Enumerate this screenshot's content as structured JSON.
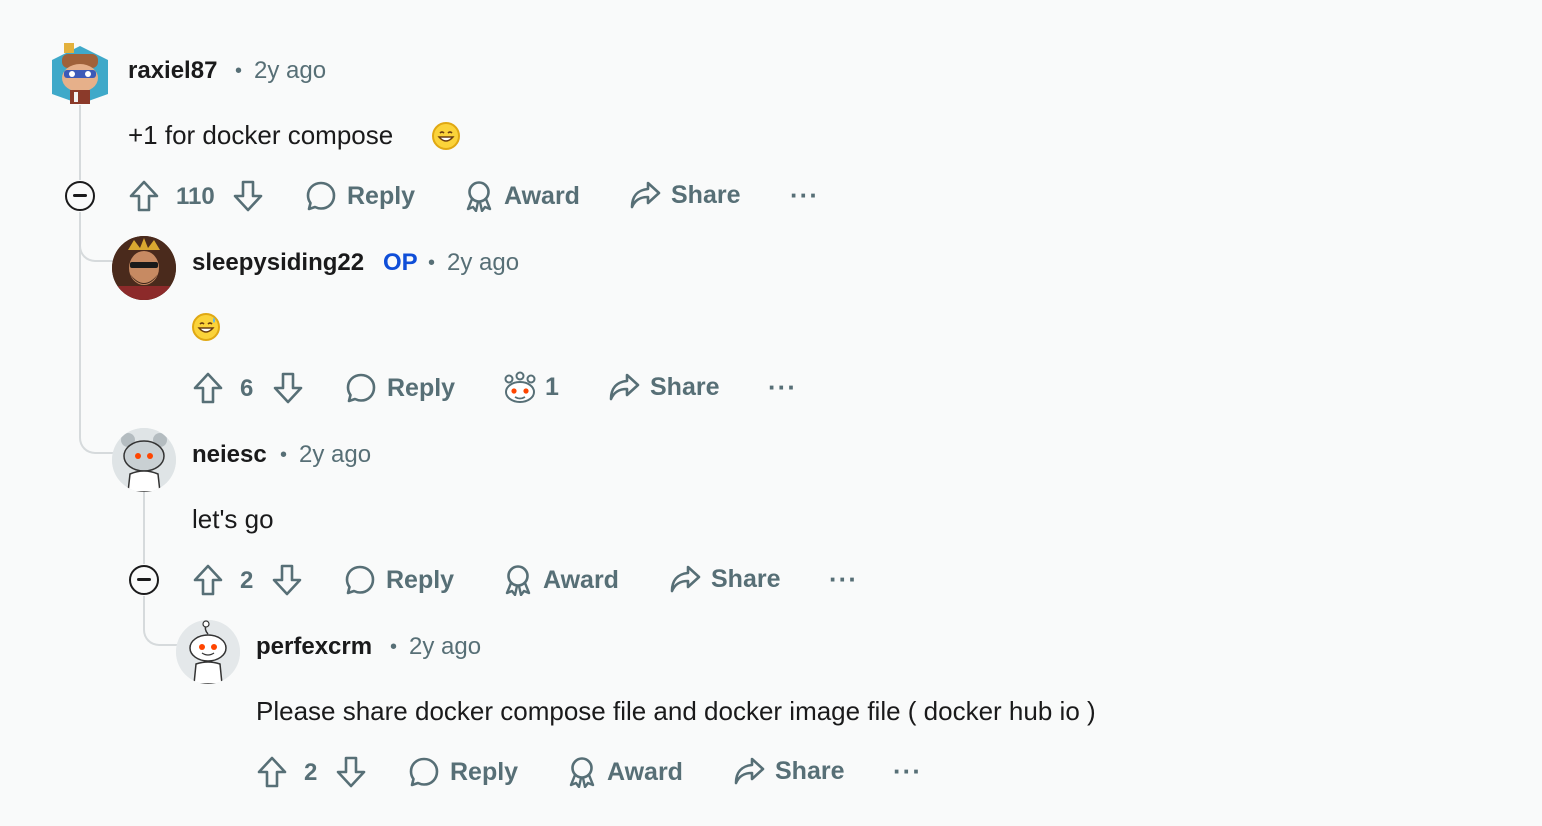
{
  "comments": [
    {
      "username": "raxiel87",
      "time": "2y ago",
      "text": "+1 for docker compose",
      "emoji": "grinning-face-emoji",
      "votes": "110",
      "reply_label": "Reply",
      "award_label": "Award",
      "share_label": "Share",
      "more_label": "···"
    },
    {
      "username": "sleepysiding22",
      "badge": "OP",
      "time": "2y ago",
      "emoji": "grinning-sweat-emoji",
      "votes": "6",
      "reply_label": "Reply",
      "award_count": "1",
      "share_label": "Share",
      "more_label": "···"
    },
    {
      "username": "neiesc",
      "time": "2y ago",
      "text": "let's go",
      "votes": "2",
      "reply_label": "Reply",
      "award_label": "Award",
      "share_label": "Share",
      "more_label": "···"
    },
    {
      "username": "perfexcrm",
      "time": "2y ago",
      "text": "Please share docker compose file and docker image file ( docker hub io )",
      "votes": "2",
      "reply_label": "Reply",
      "award_label": "Award",
      "share_label": "Share",
      "more_label": "···"
    }
  ],
  "separator": "•",
  "colors": {
    "background": "#f9fafa",
    "meta_text": "#576f76",
    "op_badge": "#0f4ed8",
    "thread_line": "#d6dadc"
  }
}
